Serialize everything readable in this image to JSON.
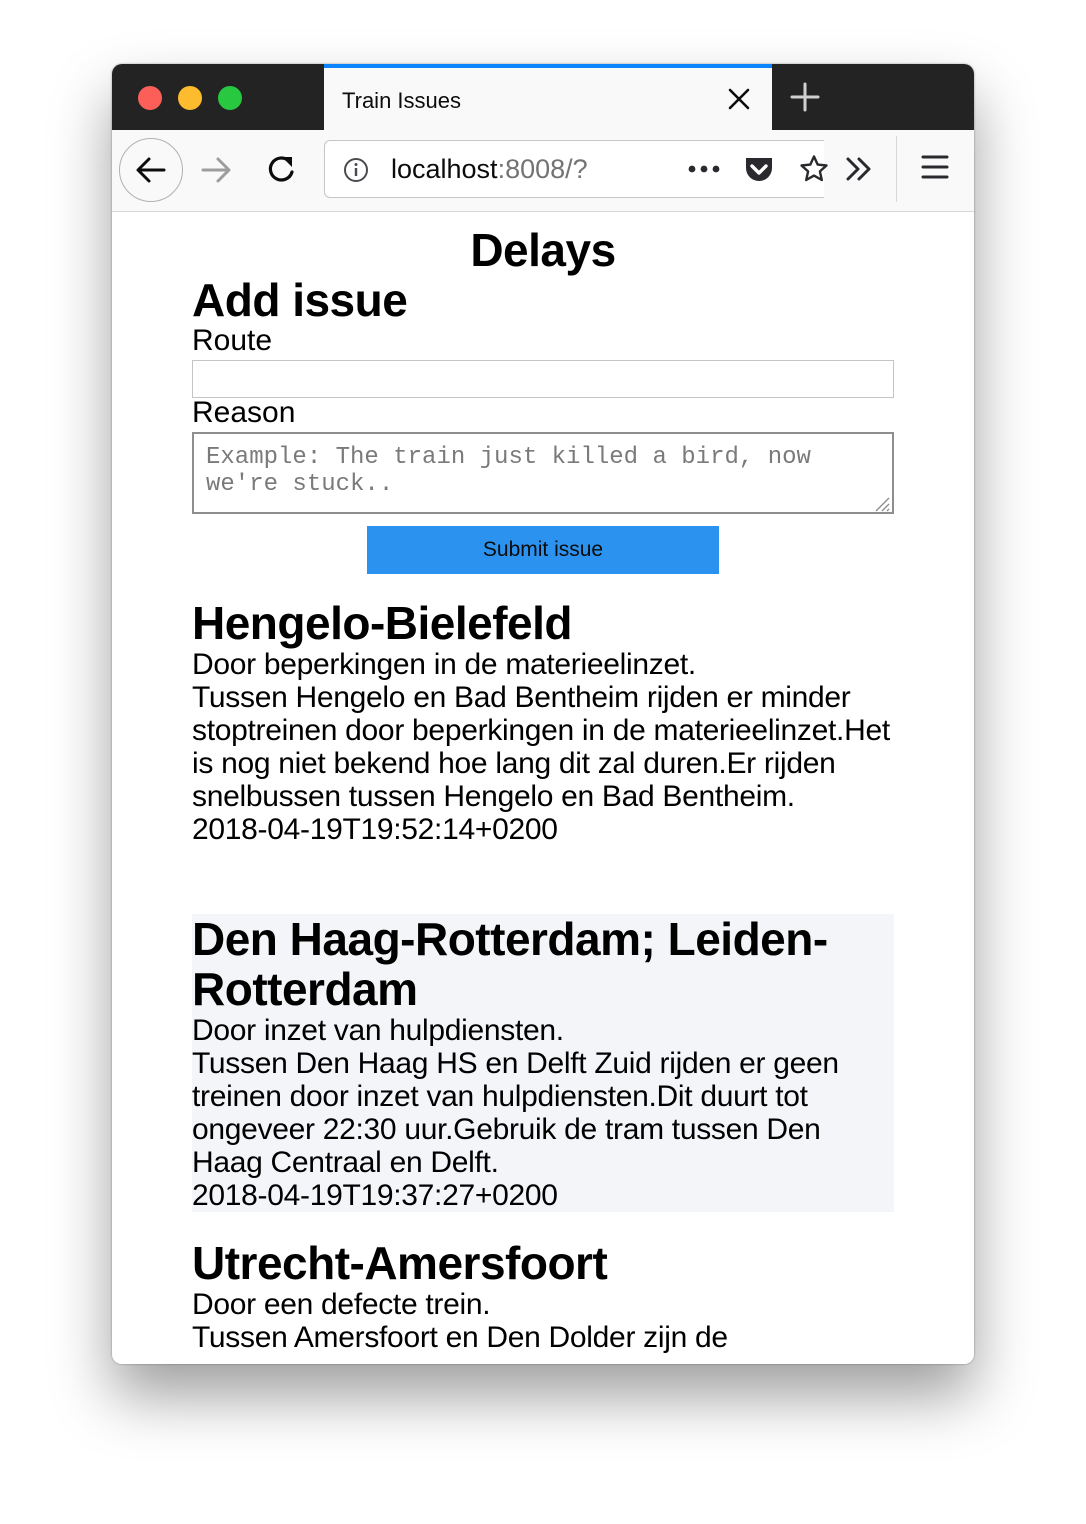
{
  "browser": {
    "tab_title": "Train Issues",
    "url_host": "localhost",
    "url_rest": ":8008/?"
  },
  "page": {
    "title": "Delays",
    "form": {
      "heading": "Add issue",
      "route_label": "Route",
      "route_value": "",
      "reason_label": "Reason",
      "reason_placeholder": "Example: The train just killed a bird, now we're stuck..",
      "submit_label": "Submit issue"
    },
    "issues": [
      {
        "route": "Hengelo-Bielefeld",
        "cause": "Door beperkingen in de materieelinzet.",
        "description": "Tussen Hengelo en Bad Bentheim rijden er minder stoptreinen door beperkingen in de materieelinzet.Het is nog niet bekend hoe lang dit zal duren.Er rijden snelbussen tussen Hengelo en Bad Bentheim.",
        "timestamp": "2018-04-19T19:52:14+0200"
      },
      {
        "route": "Den Haag-Rotterdam; Leiden-Rotterdam",
        "cause": "Door inzet van hulpdiensten.",
        "description": "Tussen Den Haag HS en Delft Zuid rijden er geen treinen door inzet van hulpdiensten.Dit duurt tot ongeveer 22:30 uur.Gebruik de tram tussen Den Haag Centraal en Delft.",
        "timestamp": "2018-04-19T19:37:27+0200"
      },
      {
        "route": "Utrecht-Amersfoort",
        "cause": "Door een defecte trein.",
        "description": "Tussen Amersfoort en Den Dolder zijn de",
        "timestamp": ""
      }
    ]
  },
  "colors": {
    "tab_accent": "#0a84ff",
    "submit_bg": "#2b93ef",
    "alt_row_bg": "#f3f5f8"
  }
}
